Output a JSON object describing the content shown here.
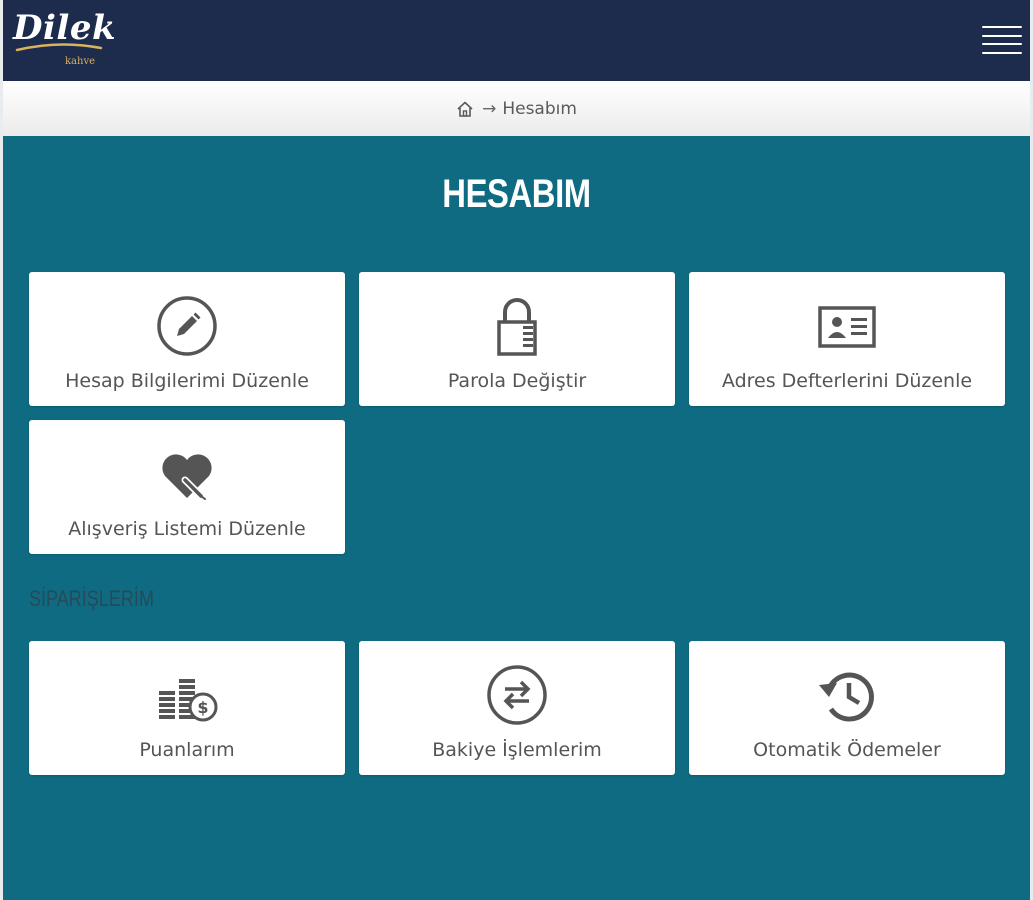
{
  "header": {
    "logo_text": "Dilek",
    "logo_subtext": "kahve",
    "background": "#1d2b4d"
  },
  "breadcrumb": {
    "arrow": "→",
    "current": "Hesabım"
  },
  "page_title": "HESABIM",
  "account_cards": [
    {
      "label": "Hesap Bilgilerimi Düzenle",
      "icon": "edit-pencil-icon"
    },
    {
      "label": "Parola Değiştir",
      "icon": "padlock-icon"
    },
    {
      "label": "Adres Defterlerini Düzenle",
      "icon": "address-card-icon"
    },
    {
      "label": "Alışveriş Listemi Düzenle",
      "icon": "heart-pencil-icon"
    }
  ],
  "orders_section_title": "SİPARİŞLERİM",
  "order_cards": [
    {
      "label": "Puanlarım",
      "icon": "coins-icon"
    },
    {
      "label": "Bakiye İşlemlerim",
      "icon": "exchange-arrows-icon"
    },
    {
      "label": "Otomatik Ödemeler",
      "icon": "history-clock-icon"
    }
  ],
  "colors": {
    "content_background": "#0f6b82",
    "card_background": "#ffffff",
    "icon_color": "#555555",
    "logo_accent": "#d9b25f"
  }
}
